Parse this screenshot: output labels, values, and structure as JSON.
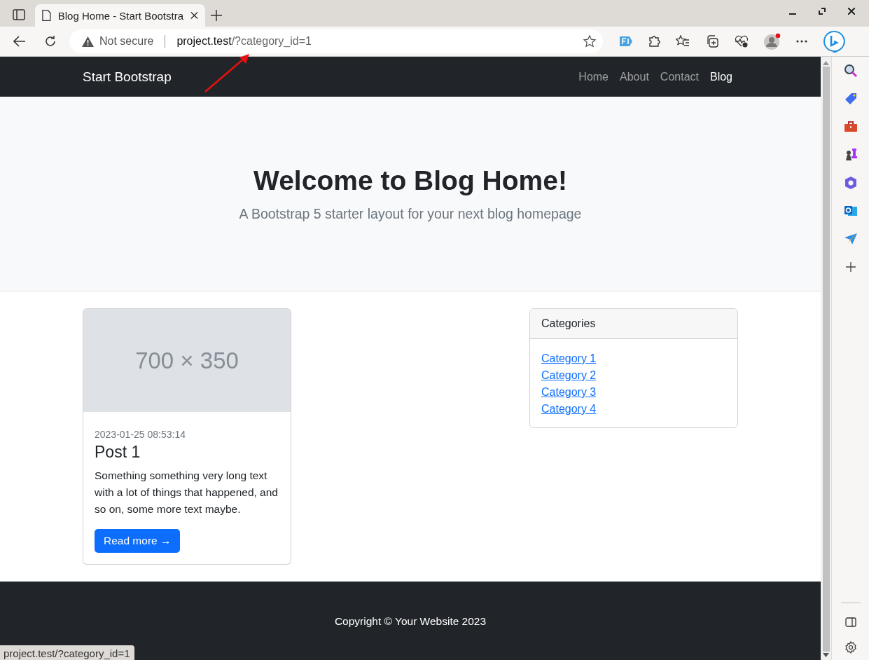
{
  "browser": {
    "tab": {
      "title": "Blog Home - Start Bootstra",
      "selected": true
    },
    "address": {
      "security": "Not secure",
      "host": "project.test",
      "path": "/?category_id=1"
    },
    "status_text": "project.test/?category_id=1"
  },
  "navbar": {
    "brand": "Start Bootstrap",
    "links": [
      {
        "label": "Home",
        "selected": false
      },
      {
        "label": "About",
        "selected": false
      },
      {
        "label": "Contact",
        "selected": false
      },
      {
        "label": "Blog",
        "selected": true
      }
    ]
  },
  "hero": {
    "title": "Welcome to Blog Home!",
    "subtitle": "A Bootstrap 5 starter layout for your next blog homepage"
  },
  "posts": [
    {
      "image_placeholder": "700 × 350",
      "date": "2023-01-25 08:53:14",
      "title": "Post 1",
      "text": "Something something very long text with a lot of things that happened, and so on, some more text maybe.",
      "button": "Read more →"
    }
  ],
  "categories": {
    "header": "Categories",
    "items": [
      "Category 1",
      "Category 2",
      "Category 3",
      "Category 4"
    ]
  },
  "footer": {
    "text": "Copyright © Your Website 2023"
  }
}
